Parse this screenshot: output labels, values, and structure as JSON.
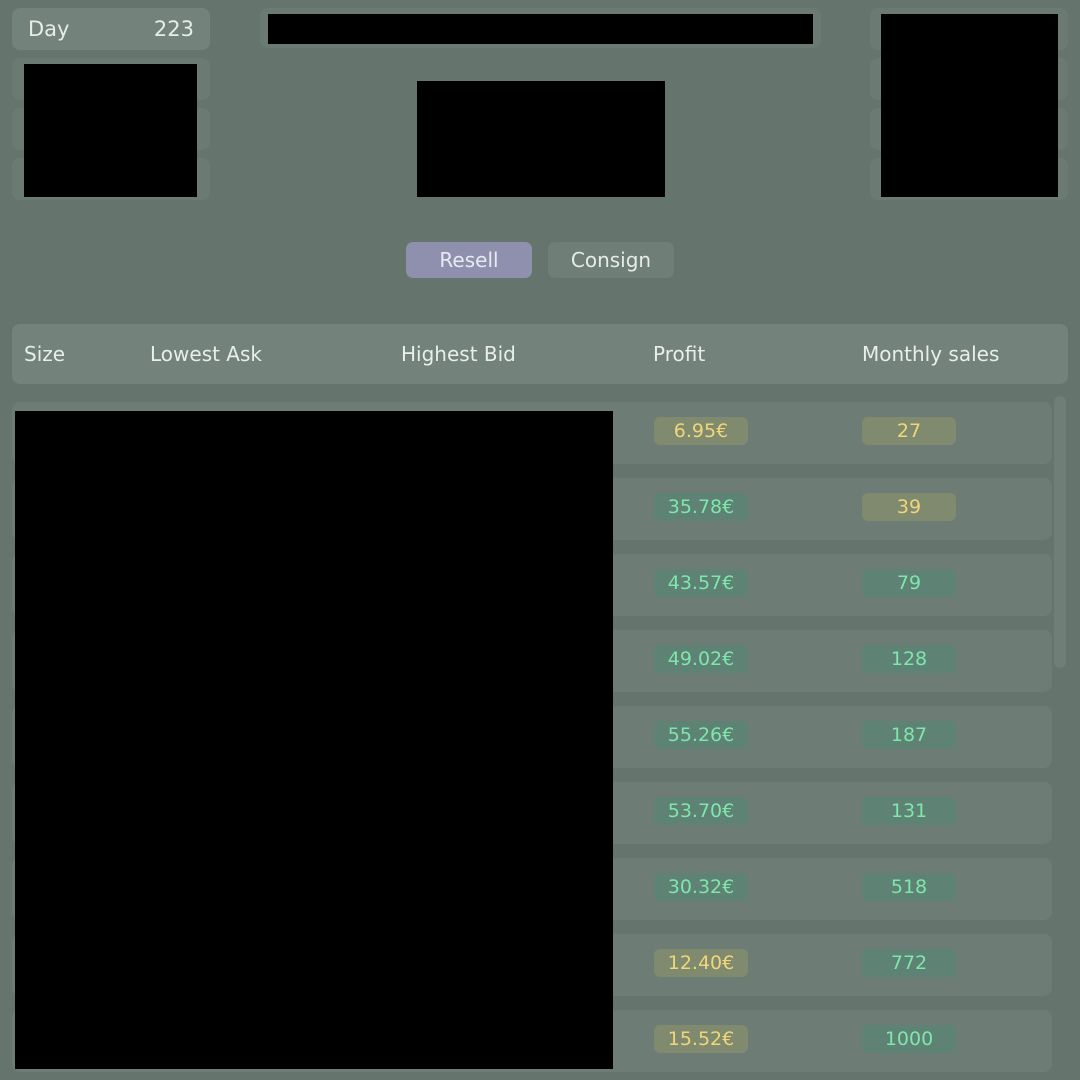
{
  "header": {
    "day_label": "Day",
    "day_value": "223"
  },
  "mode_toggle": {
    "options": [
      {
        "label": "Resell",
        "selected": true
      },
      {
        "label": "Consign",
        "selected": false
      }
    ]
  },
  "table": {
    "columns": [
      "Size",
      "Lowest Ask",
      "Highest Bid",
      "Profit",
      "Monthly sales"
    ],
    "rows": [
      {
        "profit": "6.95€",
        "profit_tone": "warn",
        "sales": "27",
        "sales_tone": "warn"
      },
      {
        "profit": "35.78€",
        "profit_tone": "good",
        "sales": "39",
        "sales_tone": "warn"
      },
      {
        "profit": "43.57€",
        "profit_tone": "good",
        "sales": "79",
        "sales_tone": "good"
      },
      {
        "profit": "49.02€",
        "profit_tone": "good",
        "sales": "128",
        "sales_tone": "good"
      },
      {
        "profit": "55.26€",
        "profit_tone": "good",
        "sales": "187",
        "sales_tone": "good"
      },
      {
        "profit": "53.70€",
        "profit_tone": "good",
        "sales": "131",
        "sales_tone": "good"
      },
      {
        "profit": "30.32€",
        "profit_tone": "good",
        "sales": "518",
        "sales_tone": "good"
      },
      {
        "profit": "12.40€",
        "profit_tone": "warn",
        "sales": "772",
        "sales_tone": "good"
      },
      {
        "profit": "15.52€",
        "profit_tone": "warn",
        "sales": "1000",
        "sales_tone": "good"
      }
    ]
  },
  "colors": {
    "background": "#65756d",
    "panel": "#73837b",
    "selected_tab": "#8e90ad",
    "good_text": "#7fe6ad",
    "warn_text": "#f0d67a"
  }
}
